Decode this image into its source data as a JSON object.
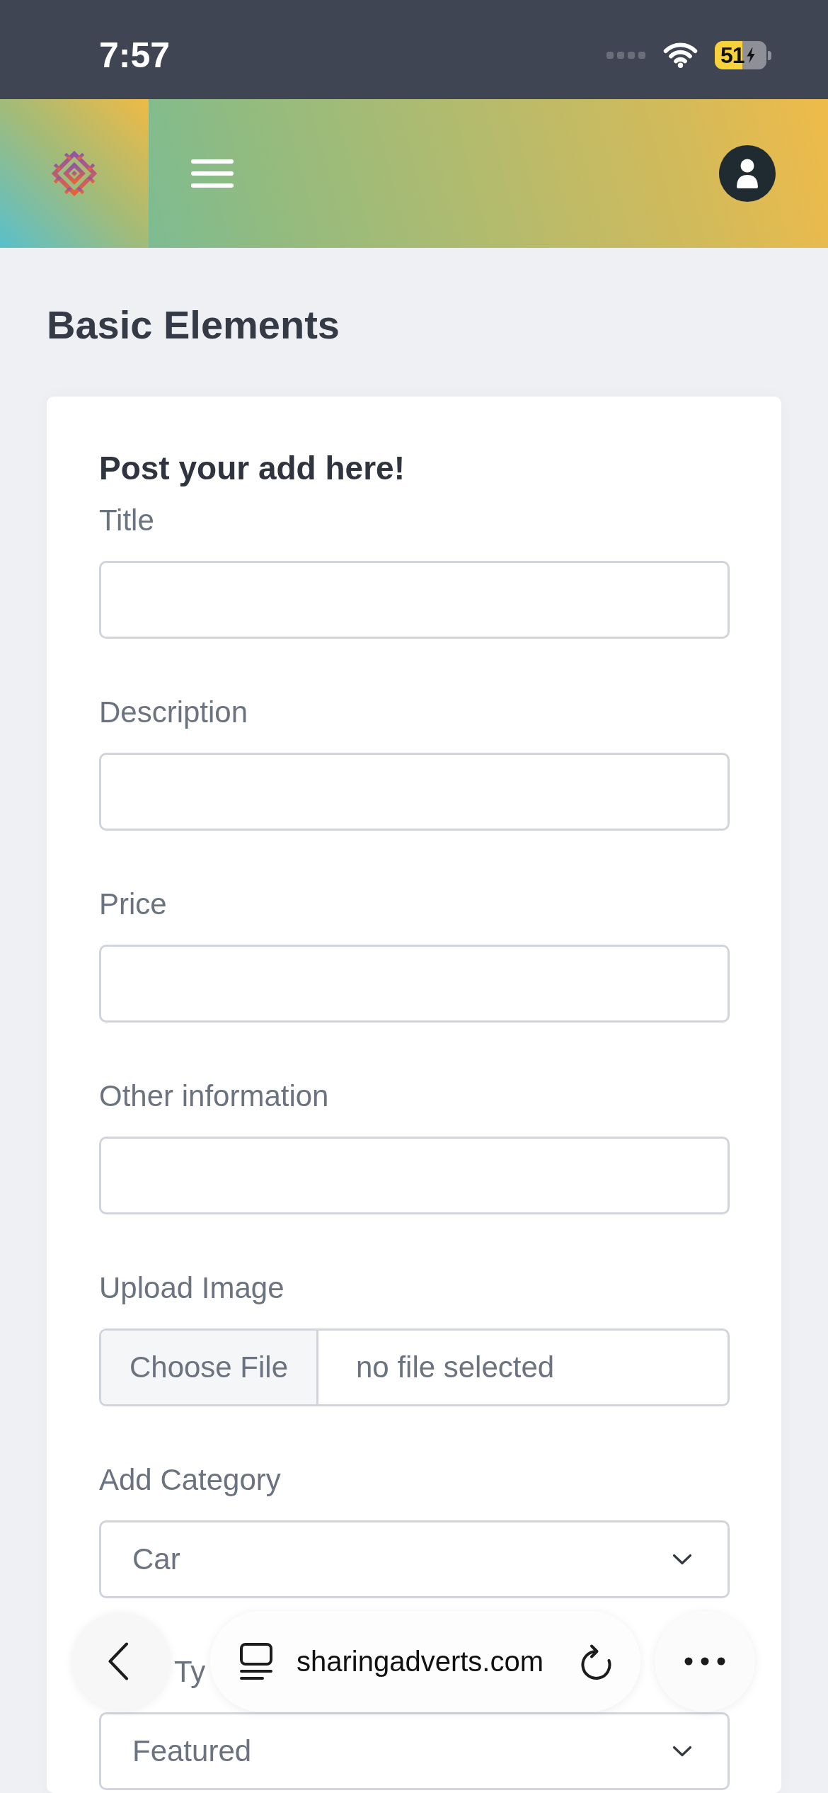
{
  "status_bar": {
    "time": "7:57",
    "battery_text": "51",
    "charging": true
  },
  "page": {
    "title": "Basic Elements"
  },
  "form": {
    "heading": "Post your add here!",
    "fields": [
      {
        "kind": "text",
        "label": "Title"
      },
      {
        "kind": "text",
        "label": "Description"
      },
      {
        "kind": "text",
        "label": "Price"
      },
      {
        "kind": "text",
        "label": "Other information"
      },
      {
        "kind": "file",
        "label": "Upload Image",
        "button": "Choose File",
        "value": "no file selected"
      },
      {
        "kind": "select",
        "label": "Add Category",
        "value": "Car"
      },
      {
        "kind": "select",
        "label": "Ty",
        "value": "Featured",
        "partly_covered": true
      }
    ]
  },
  "browser_bar": {
    "url": "sharingadverts.com"
  }
}
